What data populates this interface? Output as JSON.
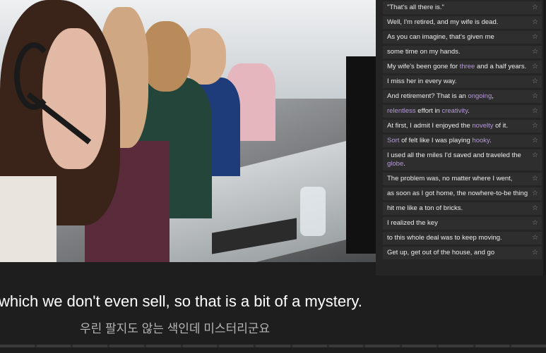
{
  "video": {
    "subtitle_en": "which we don't even sell, so that is a bit of a mystery.",
    "subtitle_ko": "우린 팔지도 않는 색인데 미스터리군요"
  },
  "transcript": {
    "star_icon": "☆",
    "lines": [
      {
        "parts": [
          {
            "t": "\"That's all there is.\""
          }
        ]
      },
      {
        "parts": [
          {
            "t": "Well, I'm retired, and my wife is dead."
          }
        ]
      },
      {
        "parts": [
          {
            "t": "As you can imagine, that's given me"
          }
        ]
      },
      {
        "parts": [
          {
            "t": "some time on my hands."
          }
        ]
      },
      {
        "parts": [
          {
            "t": "My wife's been gone for "
          },
          {
            "t": "three",
            "hl": true
          },
          {
            "t": " and a half years."
          }
        ]
      },
      {
        "parts": [
          {
            "t": "I miss her in every way."
          }
        ]
      },
      {
        "parts": [
          {
            "t": "And retirement? That is an "
          },
          {
            "t": "ongoing",
            "hl": true
          },
          {
            "t": ","
          }
        ]
      },
      {
        "parts": [
          {
            "t": "relentless",
            "hl": true
          },
          {
            "t": " effort in "
          },
          {
            "t": "creativity",
            "hl": true
          },
          {
            "t": "."
          }
        ]
      },
      {
        "parts": [
          {
            "t": "At first, I admit I enjoyed the "
          },
          {
            "t": "novelty",
            "hl": true
          },
          {
            "t": " of it."
          }
        ]
      },
      {
        "parts": [
          {
            "t": "Sort",
            "hl": true
          },
          {
            "t": " of felt like I was playing "
          },
          {
            "t": "hooky",
            "hl": true
          },
          {
            "t": "."
          }
        ]
      },
      {
        "parts": [
          {
            "t": "I used all the miles I'd saved and traveled the "
          },
          {
            "t": "globe",
            "hl": true
          },
          {
            "t": "."
          }
        ]
      },
      {
        "parts": [
          {
            "t": "The problem was, no matter where I went,"
          }
        ]
      },
      {
        "parts": [
          {
            "t": "as soon as I got home, the nowhere-to-be thing"
          }
        ]
      },
      {
        "parts": [
          {
            "t": "hit me like a ton of bricks."
          }
        ]
      },
      {
        "parts": [
          {
            "t": "I realized the key"
          }
        ]
      },
      {
        "parts": [
          {
            "t": "to this whole deal was to keep moving."
          }
        ]
      },
      {
        "parts": [
          {
            "t": "Get up, get out of the house, and go"
          }
        ]
      }
    ]
  }
}
